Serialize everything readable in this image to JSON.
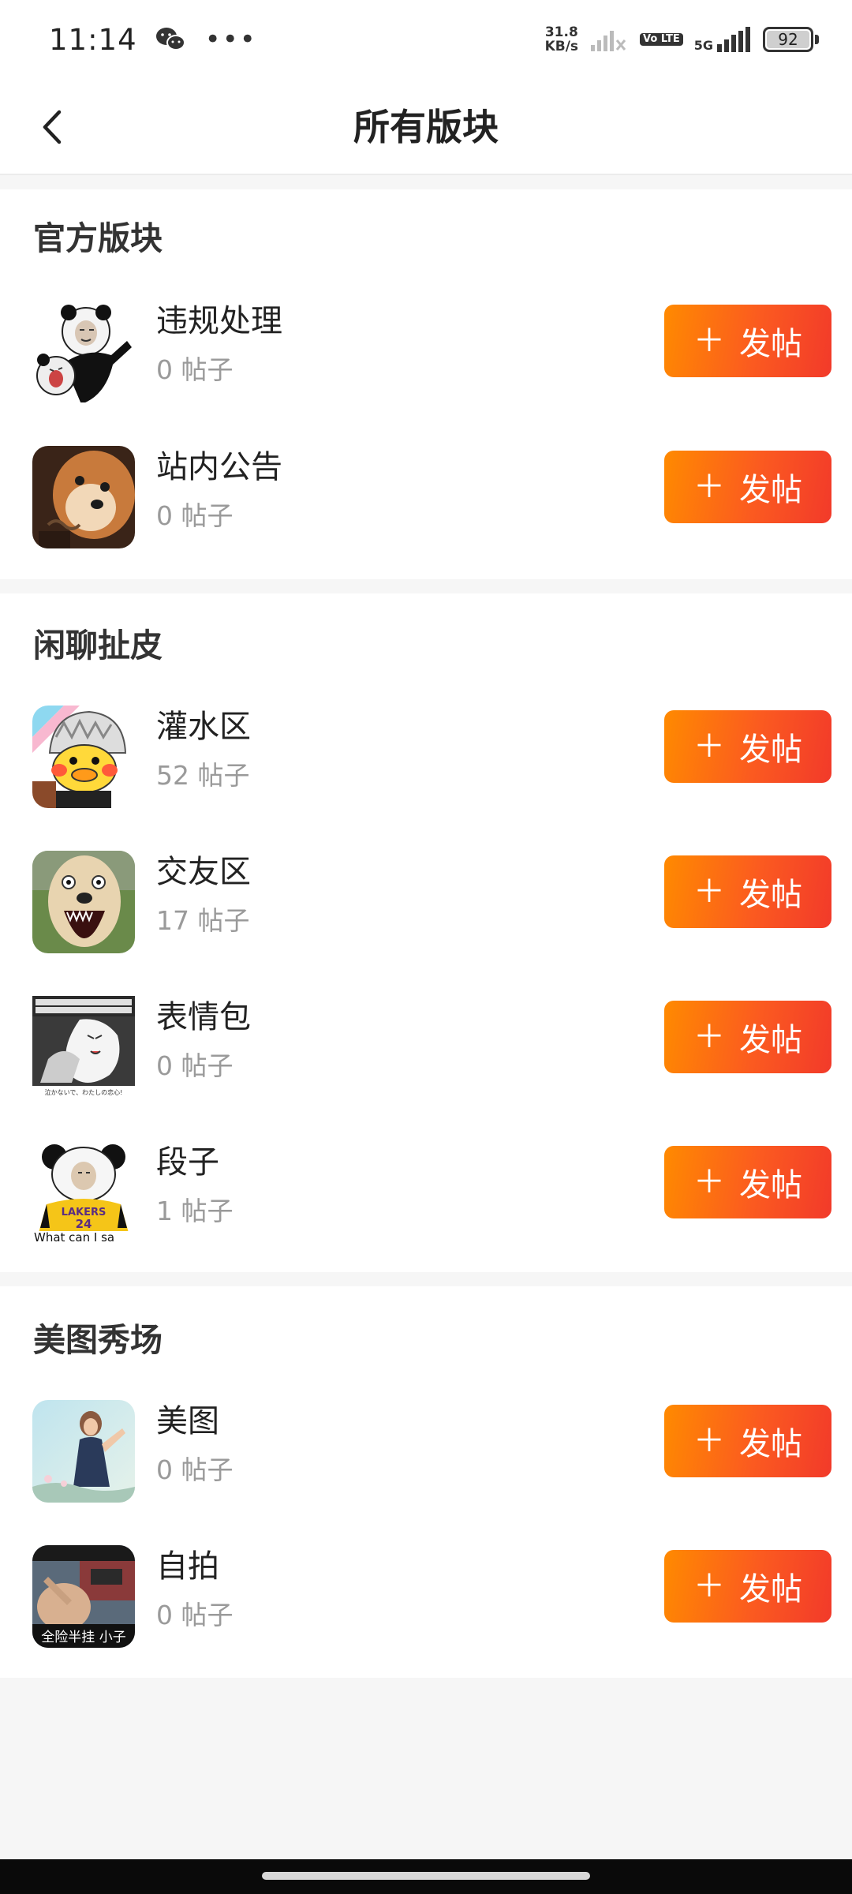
{
  "status_bar": {
    "time": "11:14",
    "net_speed_value": "31.8",
    "net_speed_unit": "KB/s",
    "volte": "Vo LTE",
    "network": "5G",
    "battery": "92"
  },
  "header": {
    "title": "所有版块"
  },
  "sections": [
    {
      "title": "官方版块",
      "boards": [
        {
          "name": "违规处理",
          "count": "0 帖子",
          "button": "发帖",
          "thumb": "panda-meme"
        },
        {
          "name": "站内公告",
          "count": "0 帖子",
          "button": "发帖",
          "thumb": "shiba-dog"
        }
      ]
    },
    {
      "title": "闲聊扯皮",
      "boards": [
        {
          "name": "灌水区",
          "count": "52 帖子",
          "button": "发帖",
          "thumb": "cartoon-duck"
        },
        {
          "name": "交友区",
          "count": "17 帖子",
          "button": "发帖",
          "thumb": "screaming-dog"
        },
        {
          "name": "表情包",
          "count": "0 帖子",
          "button": "发帖",
          "thumb": "anime-manga"
        },
        {
          "name": "段子",
          "count": "1 帖子",
          "button": "发帖",
          "thumb": "panda-lakers",
          "caption": "What can I sa"
        }
      ]
    },
    {
      "title": "美图秀场",
      "boards": [
        {
          "name": "美图",
          "count": "0 帖子",
          "button": "发帖",
          "thumb": "girl-photo"
        },
        {
          "name": "自拍",
          "count": "0 帖子",
          "button": "发帖",
          "thumb": "car-selfie",
          "caption": "全险半挂 小子"
        }
      ]
    }
  ],
  "thumb_captions": {
    "manga_bottom": "泣かないで、わたしの恋心!",
    "lakers_text": "LAKERS",
    "lakers_number": "24"
  },
  "colors": {
    "button_gradient_start": "#ff8a00",
    "button_gradient_end": "#f23a2a",
    "count_gray": "#9a9a9a",
    "page_bg": "#f6f6f6"
  }
}
